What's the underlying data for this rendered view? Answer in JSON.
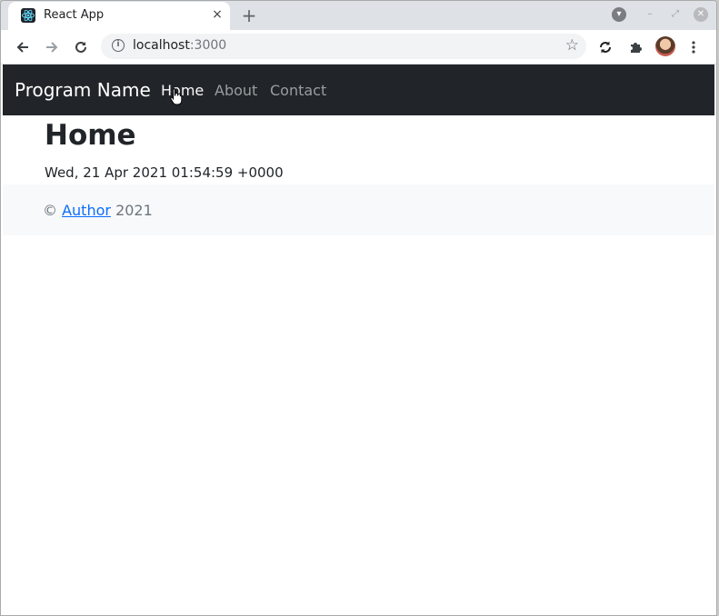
{
  "browser": {
    "tab_title": "React App",
    "tab_close": "×",
    "new_tab": "+",
    "url_host": "localhost",
    "url_port": ":3000"
  },
  "navbar": {
    "brand": "Program Name",
    "links": [
      {
        "label": "Home",
        "active": true
      },
      {
        "label": "About",
        "active": false
      },
      {
        "label": "Contact",
        "active": false
      }
    ]
  },
  "main": {
    "title": "Home",
    "timestamp": "Wed, 21 Apr 2021 01:54:59 +0000"
  },
  "footer": {
    "copyright_symbol": "©",
    "author_link": "Author",
    "year": "2021"
  },
  "colors": {
    "navbar_bg": "#212529",
    "nav_active": "#f8f9fa",
    "nav_inactive": "#9a9da0",
    "link": "#0d6efd",
    "footer_bg": "#f8f9fa"
  }
}
